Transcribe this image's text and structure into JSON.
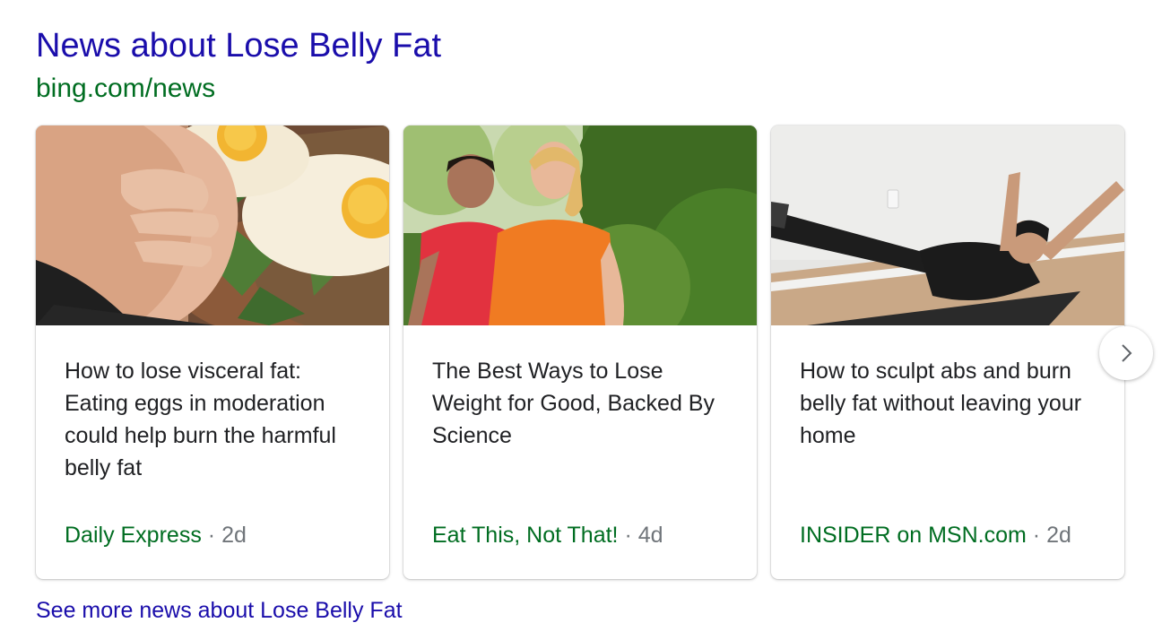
{
  "section": {
    "title": "News about Lose Belly Fat",
    "source_url": "bing.com/news",
    "see_more": "See more news about Lose Belly Fat"
  },
  "cards": [
    {
      "headline": "How to lose visceral fat: Eating eggs in moderation could help burn the harmful belly fat",
      "publisher": "Daily Express",
      "separator": "·",
      "age": "2d"
    },
    {
      "headline": "The Best Ways to Lose Weight for Good, Backed By Science",
      "publisher": "Eat This, Not That!",
      "separator": "·",
      "age": "4d"
    },
    {
      "headline": "How to sculpt abs and burn belly fat without leaving your home",
      "publisher": "INSIDER on MSN.com",
      "separator": "·",
      "age": "2d"
    }
  ],
  "carousel": {
    "next_icon": "chevron-right-icon"
  },
  "colors": {
    "link_blue": "#1a0dab",
    "source_green": "#006d21",
    "meta_gray": "#70757a",
    "text": "#202124"
  }
}
